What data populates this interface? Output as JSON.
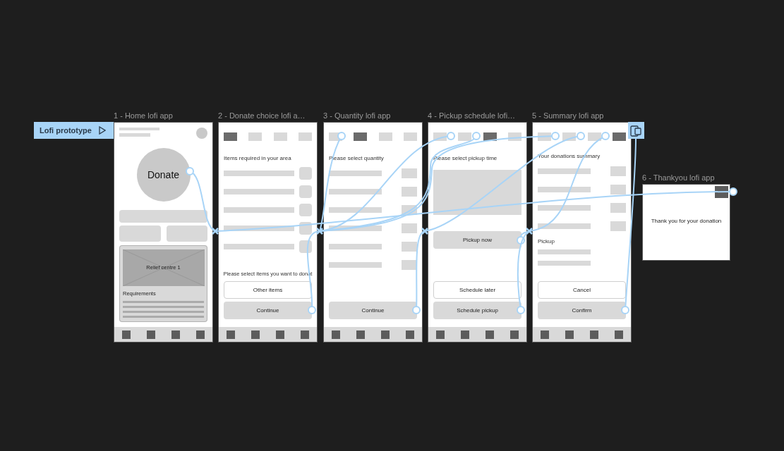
{
  "flow": {
    "label": "Lofi prototype"
  },
  "frames": [
    {
      "kind": "home",
      "title": "1 - Home lofi app",
      "cta": "Donate",
      "card_title": "Relief centre 1",
      "card_label": "Requirements"
    },
    {
      "kind": "list",
      "title": "2 - Donate choice lofi a…",
      "tabs": [
        {
          "selected": true
        },
        {
          "selected": false
        },
        {
          "selected": false
        },
        {
          "selected": false
        }
      ],
      "heading": "Items required in your area",
      "rows": [
        {
          "checked": false
        },
        {
          "checked": false
        },
        {
          "checked": false
        },
        {
          "checked": false
        },
        {
          "checked": false
        }
      ],
      "prompt": "Please select items you want to donat",
      "buttons": [
        {
          "label": "Other items",
          "kind": "outline"
        },
        {
          "label": "Continue",
          "kind": "filled"
        }
      ]
    },
    {
      "kind": "quantity",
      "title": "3 - Quantity lofi app",
      "tabs": [
        {
          "selected": false
        },
        {
          "selected": true
        },
        {
          "selected": false
        },
        {
          "selected": false
        }
      ],
      "heading": "Please select quantity",
      "buttons": [
        {
          "label": "Continue",
          "kind": "filled"
        }
      ]
    },
    {
      "kind": "schedule",
      "title": "4 - Pickup schedule lofi…",
      "tabs": [
        {
          "selected": false
        },
        {
          "selected": false
        },
        {
          "selected": true
        },
        {
          "selected": false
        }
      ],
      "heading": "Please select pickup time",
      "buttons": [
        {
          "label": "Pickup now",
          "kind": "filled"
        },
        {
          "label": "Schedule later",
          "kind": "outline"
        },
        {
          "label": "Schedule pickup",
          "kind": "filled"
        }
      ]
    },
    {
      "kind": "summary",
      "title": "5 - Summary lofi app",
      "tabs": [
        {
          "selected": false
        },
        {
          "selected": false
        },
        {
          "selected": false
        },
        {
          "selected": true
        }
      ],
      "heading": "Your donations summary",
      "section": "Pickup",
      "buttons": [
        {
          "label": "Cancel",
          "kind": "outline"
        },
        {
          "label": "Confirm",
          "kind": "filled"
        }
      ]
    },
    {
      "kind": "message",
      "title": "6 - Thankyou lofi app",
      "message": "Thank you for your donation"
    }
  ]
}
